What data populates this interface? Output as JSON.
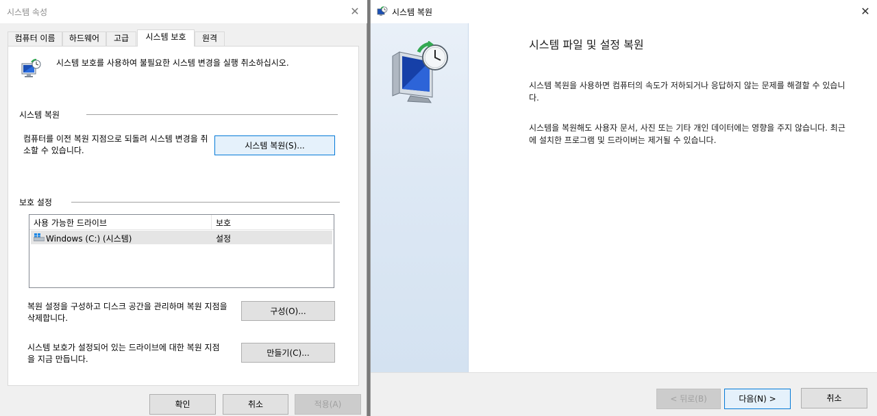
{
  "left_dialog": {
    "title": "시스템 속성",
    "tabs": [
      {
        "label": "컴퓨터 이름"
      },
      {
        "label": "하드웨어"
      },
      {
        "label": "고급"
      },
      {
        "label": "시스템 보호"
      },
      {
        "label": "원격"
      }
    ],
    "active_tab": "시스템 보호",
    "intro": "시스템 보호를 사용하여 불필요한 시스템 변경을 실행 취소하십시오.",
    "restore_group": {
      "title": "시스템 복원",
      "description": "컴퓨터를 이전 복원 지점으로 되돌려 시스템 변경을 취소할 수 있습니다.",
      "button": "시스템 복원(S)..."
    },
    "protection_group": {
      "title": "보호 설정",
      "columns": [
        "사용 가능한 드라이브",
        "보호"
      ],
      "drives": [
        {
          "name": "Windows (C:) (시스템)",
          "protection": "설정"
        }
      ],
      "configure_desc": "복원 설정을 구성하고 디스크 공간을 관리하며 복원 지점을 삭제합니다.",
      "configure_button": "구성(O)...",
      "create_desc": "시스템 보호가 설정되어 있는 드라이브에 대한 복원 지점을 지금 만듭니다.",
      "create_button": "만들기(C)..."
    },
    "footer": {
      "ok": "확인",
      "cancel": "취소",
      "apply": "적용(A)"
    }
  },
  "right_dialog": {
    "title": "시스템 복원",
    "heading": "시스템 파일 및 설정 복원",
    "paragraph1": "시스템 복원을 사용하면 컴퓨터의 속도가 저하되거나 응답하지 않는 문제를 해결할 수 있습니다.",
    "paragraph2": "시스템을 복원해도 사용자 문서, 사진 또는 기타 개인 데이터에는 영향을 주지 않습니다. 최근에 설치한 프로그램 및 드라이버는 제거될 수 있습니다.",
    "footer": {
      "back": "< 뒤로(B)",
      "next": "다음(N) >",
      "cancel": "취소"
    }
  },
  "icons": {
    "close": "close-icon",
    "shield": "system-protection-icon",
    "drive": "windows-drive-icon",
    "restore": "system-restore-icon"
  },
  "colors": {
    "focus_border": "#0078d7",
    "focus_fill": "#e5f1fb",
    "side_pane": "#dde8f4"
  }
}
